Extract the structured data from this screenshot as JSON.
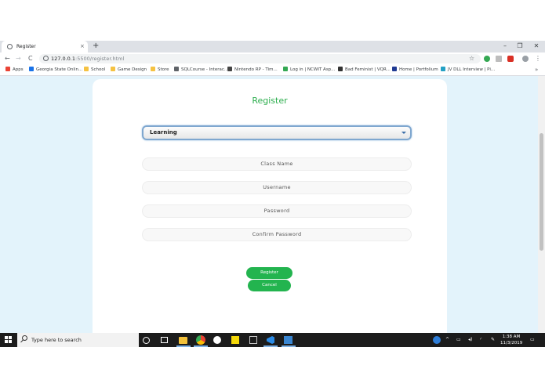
{
  "browser": {
    "tab_title": "Register",
    "tab_close": "×",
    "new_tab": "+",
    "window_controls": {
      "minimize": "–",
      "restore": "❐",
      "close": "✕"
    },
    "url_host": "127.0.0.1",
    "url_path": ":5500/register.html",
    "nav": {
      "back": "←",
      "forward": "→",
      "reload": "C"
    },
    "bookmarks": [
      {
        "label": "Apps",
        "color": "#ea4335"
      },
      {
        "label": "Georgia State Onlin...",
        "color": "#1a73e8"
      },
      {
        "label": "School",
        "color": "#f5c242"
      },
      {
        "label": "Game Design",
        "color": "#f5c242"
      },
      {
        "label": "Store",
        "color": "#f5c242"
      },
      {
        "label": "SQLCourse - Interac...",
        "color": "#5f6368"
      },
      {
        "label": "Nintendo RP - Tim...",
        "color": "#444444"
      },
      {
        "label": "Log in | NCWIT Asp...",
        "color": "#34a853"
      },
      {
        "label": "Bad Feminist | VQR...",
        "color": "#333333"
      },
      {
        "label": "Home | Portfolium",
        "color": "#1f3a93"
      },
      {
        "label": "JV DLL Interview | Pi...",
        "color": "#23a0c4"
      }
    ],
    "bookmarks_more": "»"
  },
  "form": {
    "title": "Register",
    "select_value": "Learning",
    "fields": {
      "class_name": "Class Name",
      "username": "Username",
      "password": "Password",
      "confirm_password": "Confirm Password"
    },
    "register_label": "Register",
    "cancel_label": "Cancel"
  },
  "taskbar": {
    "search_placeholder": "Type here to search",
    "clock_time": "1:38 AM",
    "clock_date": "11/3/2019"
  },
  "colors": {
    "accent_green": "#2dae4e",
    "button_green": "#23b44f",
    "page_bg": "#e3f3fb",
    "taskbar": "#1c1c1c"
  }
}
